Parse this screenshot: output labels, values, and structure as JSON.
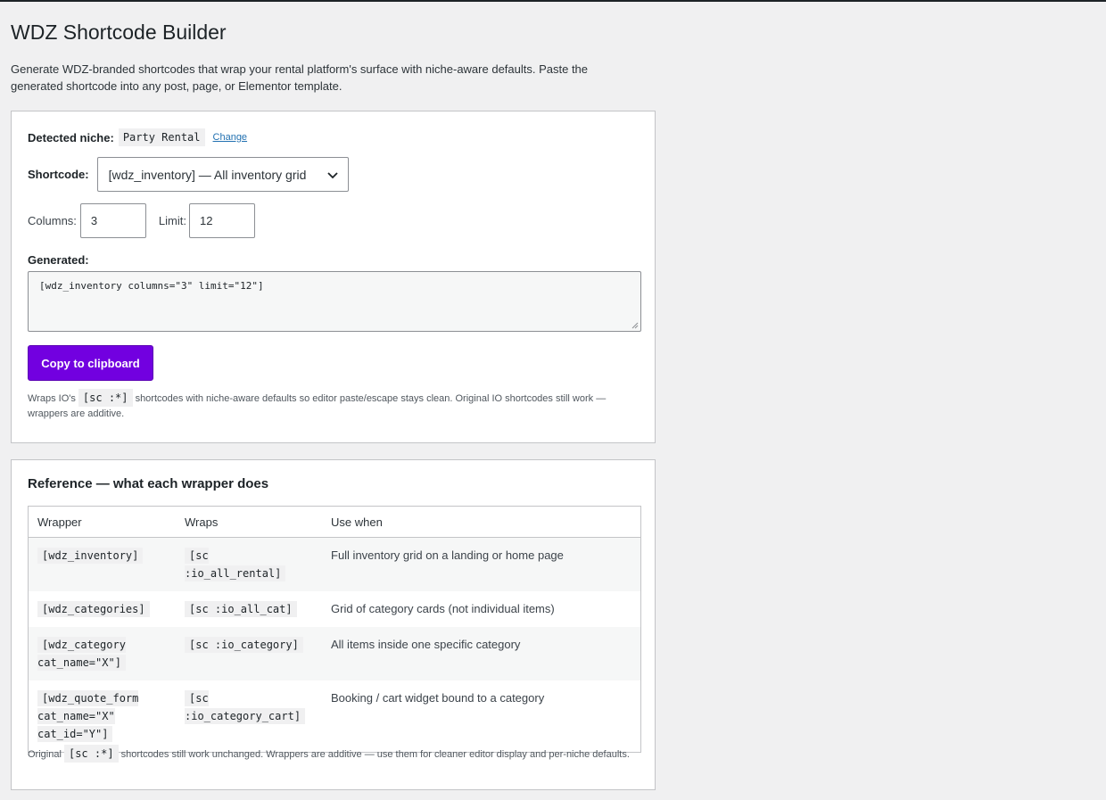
{
  "page": {
    "title": "WDZ Shortcode Builder",
    "intro": "Generate WDZ-branded shortcodes that wrap your rental platform's surface with niche-aware defaults. Paste the generated shortcode into any post, page, or Elementor template."
  },
  "builder": {
    "niche_label": "Detected niche:",
    "niche_value": "Party Rental",
    "change_link": "Change",
    "shortcode_label": "Shortcode:",
    "shortcode_selected": "[wdz_inventory] — All inventory grid",
    "columns_label": "Columns:",
    "columns_value": "3",
    "limit_label": "Limit:",
    "limit_value": "12",
    "generated_label": "Generated:",
    "generated_value": "[wdz_inventory columns=\"3\" limit=\"12\"]",
    "copy_button": "Copy to clipboard",
    "note_prefix": "Wraps IO's",
    "note_code": "[sc :*]",
    "note_suffix": "shortcodes with niche-aware defaults so editor paste/escape stays clean. Original IO shortcodes still work — wrappers are additive."
  },
  "reference": {
    "heading": "Reference — what each wrapper does",
    "columns": [
      "Wrapper",
      "Wraps",
      "Use when"
    ],
    "rows": [
      {
        "wrapper": "[wdz_inventory]",
        "wraps": "[sc :io_all_rental]",
        "use": "Full inventory grid on a landing or home page"
      },
      {
        "wrapper": "[wdz_categories]",
        "wraps": "[sc :io_all_cat]",
        "use": "Grid of category cards (not individual items)"
      },
      {
        "wrapper": "[wdz_category cat_name=\"X\"]",
        "wraps": "[sc :io_category]",
        "use": "All items inside one specific category"
      },
      {
        "wrapper": "[wdz_quote_form cat_name=\"X\" cat_id=\"Y\"]",
        "wraps": "[sc :io_category_cart]",
        "use": "Booking / cart widget bound to a category"
      }
    ],
    "foot_prefix": "Original",
    "foot_code": "[sc :*]",
    "foot_suffix": "shortcodes still work unchanged. Wrappers are additive — use them for cleaner editor display and per-niche defaults."
  },
  "icons": {
    "select_arrow": "chevron-down-icon",
    "resize": "resize-grip-icon"
  },
  "colors": {
    "accent": "#7200e0",
    "link": "#2271b1"
  }
}
